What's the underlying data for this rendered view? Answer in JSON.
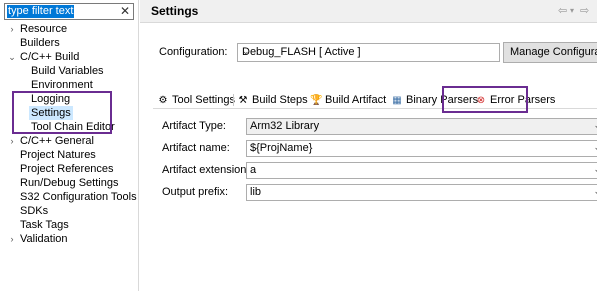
{
  "filter": {
    "value": "type filter text",
    "clear_icon": "✕"
  },
  "tree": [
    {
      "label": "Resource",
      "level": 0,
      "arrow": "›"
    },
    {
      "label": "Builders",
      "level": 0,
      "arrow": ""
    },
    {
      "label": "C/C++ Build",
      "level": 0,
      "arrow": "⌄"
    },
    {
      "label": "Build Variables",
      "level": 1
    },
    {
      "label": "Environment",
      "level": 1
    },
    {
      "label": "Logging",
      "level": 1
    },
    {
      "label": "Settings",
      "level": 1,
      "selected": true
    },
    {
      "label": "Tool Chain Editor",
      "level": 1
    },
    {
      "label": "C/C++ General",
      "level": 0,
      "arrow": "›"
    },
    {
      "label": "Project Natures",
      "level": 0,
      "arrow": ""
    },
    {
      "label": "Project References",
      "level": 0,
      "arrow": ""
    },
    {
      "label": "Run/Debug Settings",
      "level": 0,
      "arrow": ""
    },
    {
      "label": "S32 Configuration Tools",
      "level": 0,
      "arrow": ""
    },
    {
      "label": "SDKs",
      "level": 0,
      "arrow": ""
    },
    {
      "label": "Task Tags",
      "level": 0,
      "arrow": ""
    },
    {
      "label": "Validation",
      "level": 0,
      "arrow": "›"
    }
  ],
  "header": {
    "title": "Settings",
    "back_icon": "⇦",
    "fwd_icon": "⇨",
    "menu_icon": "▾"
  },
  "config": {
    "label": "Configuration:",
    "value": "Debug_FLASH  [ Active ]",
    "manage_button": "Manage Configurations..."
  },
  "tabs": [
    {
      "label": "Tool Settings",
      "icon": "⚙",
      "icon_name": "tool-settings-icon"
    },
    {
      "label": "Build Steps",
      "icon": "⚒",
      "icon_name": "build-steps-icon"
    },
    {
      "label": "Build Artifact",
      "icon": "🏆",
      "icon_name": "trophy-icon",
      "active": true
    },
    {
      "label": "Binary Parsers",
      "icon": "▦",
      "icon_name": "binary-parsers-icon"
    },
    {
      "label": "Error Parsers",
      "icon": "⊗",
      "icon_name": "error-parsers-icon"
    }
  ],
  "form": {
    "artifact_type": {
      "label": "Artifact Type:",
      "value": "Arm32 Library"
    },
    "artifact_name": {
      "label": "Artifact name:",
      "value": "${ProjName}"
    },
    "artifact_extension": {
      "label": "Artifact extension:",
      "value": "a"
    },
    "output_prefix": {
      "label": "Output prefix:",
      "value": "lib"
    }
  },
  "colors": {
    "highlight_box": "#6a2c91",
    "selection": "#cce8ff",
    "filter_selection": "#0078d7"
  }
}
